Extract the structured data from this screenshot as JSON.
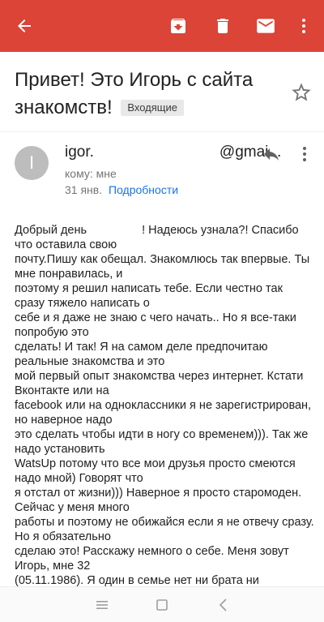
{
  "toolbar": {
    "back_icon": "arrow-back-icon",
    "archive_icon": "archive-icon",
    "delete_icon": "trash-icon",
    "mail_icon": "envelope-icon",
    "more_icon": "more-vertical-icon",
    "bar_color": "#db4437"
  },
  "message": {
    "subject": "Привет! Это Игорь с сайта знакомств!",
    "label": "Входящие",
    "star_icon": "star-outline-icon"
  },
  "sender": {
    "avatar_letter": "I",
    "address_start": "igor.",
    "address_end": "@gmai...",
    "recipient": "кому: мне",
    "date": "31 янв.",
    "details_link": "Подробности",
    "reply_icon": "reply-icon",
    "more_icon": "more-vertical-icon"
  },
  "body": {
    "greeting_start": "Добрый день",
    "greeting_end": "! Надеюсь узнала?! Спасибо",
    "lines": [
      "что оставила свою",
      "почту.Пишу как обещал. Знакомлюсь так впервые. Ты мне понравилась, и",
      "поэтому я решил написать тебе. Если честно так сразу тяжело написать о",
      "себе и я даже не знаю с чего начать.. Но я все-таки попробую это",
      "сделать! И так! Я на самом деле предпочитаю реальные знакомства и это",
      "мой первый опыт знакомства через интернет. Кстати Вконтакте или на",
      "facebook или на одноклассники я не зарегистрирован, но наверное надо",
      "это сделать чтобы идти в ногу со временем))). Так же надо установить",
      "WatsUp потому что все мои друзья просто смеются надо мной) Говорят что",
      "я отстал от жизни))) Наверное я просто старомоден. Сейчас у меня много",
      "работы и поэтому не обижайся если я не отвечу сразу. Но я обязательно",
      "сделаю это! Расскажу немного о себе. Меня зовут Игорь, мне 32",
      "(05.11.1986). Я один в семье нет ни брата ни"
    ]
  },
  "navbar": {
    "menu_icon": "menu-lines-icon",
    "home_icon": "square-home-icon",
    "back_icon": "triangle-back-icon"
  }
}
